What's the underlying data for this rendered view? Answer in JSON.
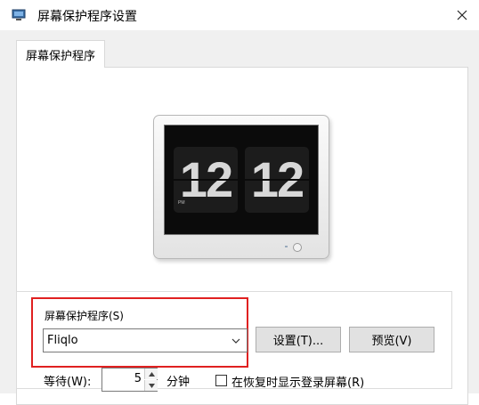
{
  "window": {
    "title": "屏幕保护程序设置"
  },
  "tabs": [
    {
      "label": "屏幕保护程序"
    }
  ],
  "preview": {
    "hours": "12",
    "minutes": "12",
    "meridiem": "PM"
  },
  "screensaver": {
    "group_label": "屏幕保护程序(S)",
    "selected": "Fliqlo",
    "settings_button": "设置(T)...",
    "preview_button": "预览(V)"
  },
  "wait": {
    "label": "等待(W):",
    "value": "5",
    "unit": "分钟"
  },
  "resume_login": {
    "label": "在恢复时显示登录屏幕(R)",
    "checked": false
  },
  "colors": {
    "highlight": "#e02020"
  }
}
